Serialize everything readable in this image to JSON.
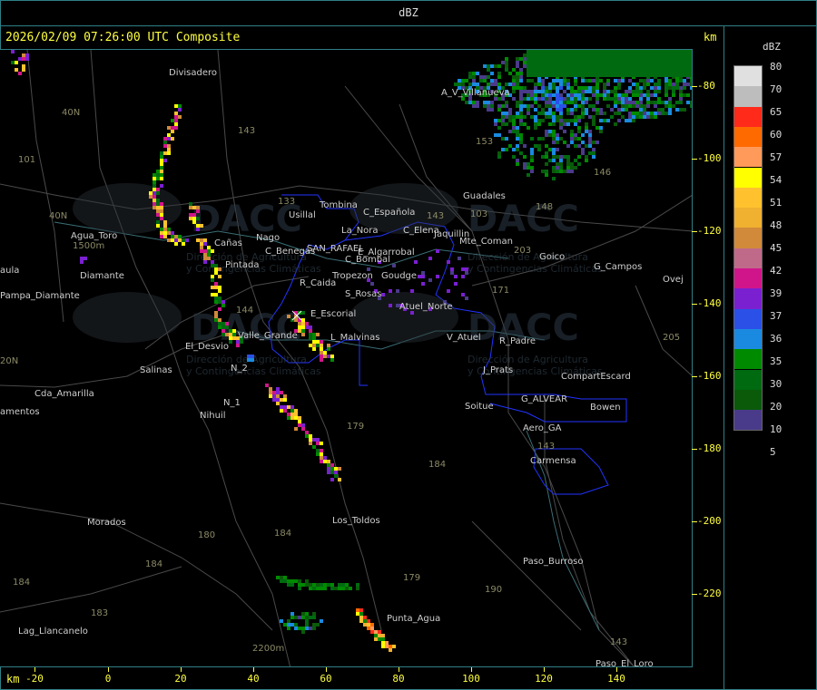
{
  "header": {
    "title": "dBZ"
  },
  "plot": {
    "timestamp": "2026/02/09 07:26:00 UTC Composite",
    "km_label_top": "km",
    "km_label_bottom": "km",
    "y_ticks": [
      "-80",
      "-100",
      "-120",
      "-140",
      "-160",
      "-180",
      "-200",
      "-220"
    ],
    "x_ticks": [
      "-20",
      "0",
      "20",
      "40",
      "60",
      "80",
      "100",
      "120",
      "140"
    ]
  },
  "legend": {
    "title": "dBZ",
    "entries": [
      {
        "value": "80",
        "color": "#e0e0e0"
      },
      {
        "value": "70",
        "color": "#bdbdbd"
      },
      {
        "value": "65",
        "color": "#ff2a1a"
      },
      {
        "value": "60",
        "color": "#ff6a00"
      },
      {
        "value": "57",
        "color": "#ff9a5a"
      },
      {
        "value": "54",
        "color": "#ffff00"
      },
      {
        "value": "51",
        "color": "#ffc22e"
      },
      {
        "value": "48",
        "color": "#f0b030"
      },
      {
        "value": "45",
        "color": "#d08a3a"
      },
      {
        "value": "42",
        "color": "#c06a8a"
      },
      {
        "value": "39",
        "color": "#d0158a"
      },
      {
        "value": "37",
        "color": "#7a20d0"
      },
      {
        "value": "36",
        "color": "#2a50e8"
      },
      {
        "value": "35",
        "color": "#1a8ae0"
      },
      {
        "value": "30",
        "color": "#008a00"
      },
      {
        "value": "20",
        "color": "#006a10"
      },
      {
        "value": "10",
        "color": "#0a5a0a"
      },
      {
        "value": "5",
        "color": "#4a3a8a"
      }
    ]
  },
  "map": {
    "watermark": "DACC",
    "watermark_sub1": "Dirección de Agricultura",
    "watermark_sub2": "y Contingencias Climáticas",
    "places": [
      "Divisadero",
      "A_V_Villanueva",
      "Guadales",
      "Usillal",
      "Tombina",
      "C_Española",
      "La_Nora",
      "C_Elena",
      "Jaquillin",
      "C_Benegas",
      "SAN_RAFAEL",
      "E_Algarrobal",
      "Mte_Coman",
      "Goico",
      "G_Campos",
      "Agua_Toro",
      "Cañas",
      "Pintada",
      "Nago",
      "C_Bombal",
      "Tropezon",
      "Goudge",
      "R_Caida",
      "S_Rosas",
      "Ovej",
      "aula",
      "Pampa_Diamante",
      "Diamante",
      "E_Escorial",
      "Atuel_Norte",
      "V_Atuel",
      "R_Padre",
      "El_Desvio",
      "Valle_Grande",
      "L_Malvinas",
      "Salinas",
      "N_2",
      "J_Prats",
      "CompartEscard",
      "Cda_Amarilla",
      "N_1",
      "Nihuil",
      "G_ALVEAR",
      "Bowen",
      "Soitue",
      "Aero_GA",
      "amentos",
      "Carmensa",
      "Morados",
      "Los_Toldos",
      "Paso_Burroso",
      "Punta_Agua",
      "Lag_Llancanelo",
      "Paso_El_Loro"
    ],
    "altitudes": [
      "1500m",
      "2200m"
    ],
    "routes": [
      "143",
      "153",
      "146",
      "143",
      "103",
      "148",
      "101",
      "40N",
      "40N",
      "133",
      "171",
      "203",
      "144",
      "20N",
      "184",
      "179",
      "180",
      "184",
      "184",
      "179",
      "190",
      "143",
      "183",
      "184",
      "205",
      "143"
    ]
  },
  "colors": {
    "frame": "#2f7f86",
    "tick": "#ffff40",
    "county_outline": "#2233ff"
  }
}
